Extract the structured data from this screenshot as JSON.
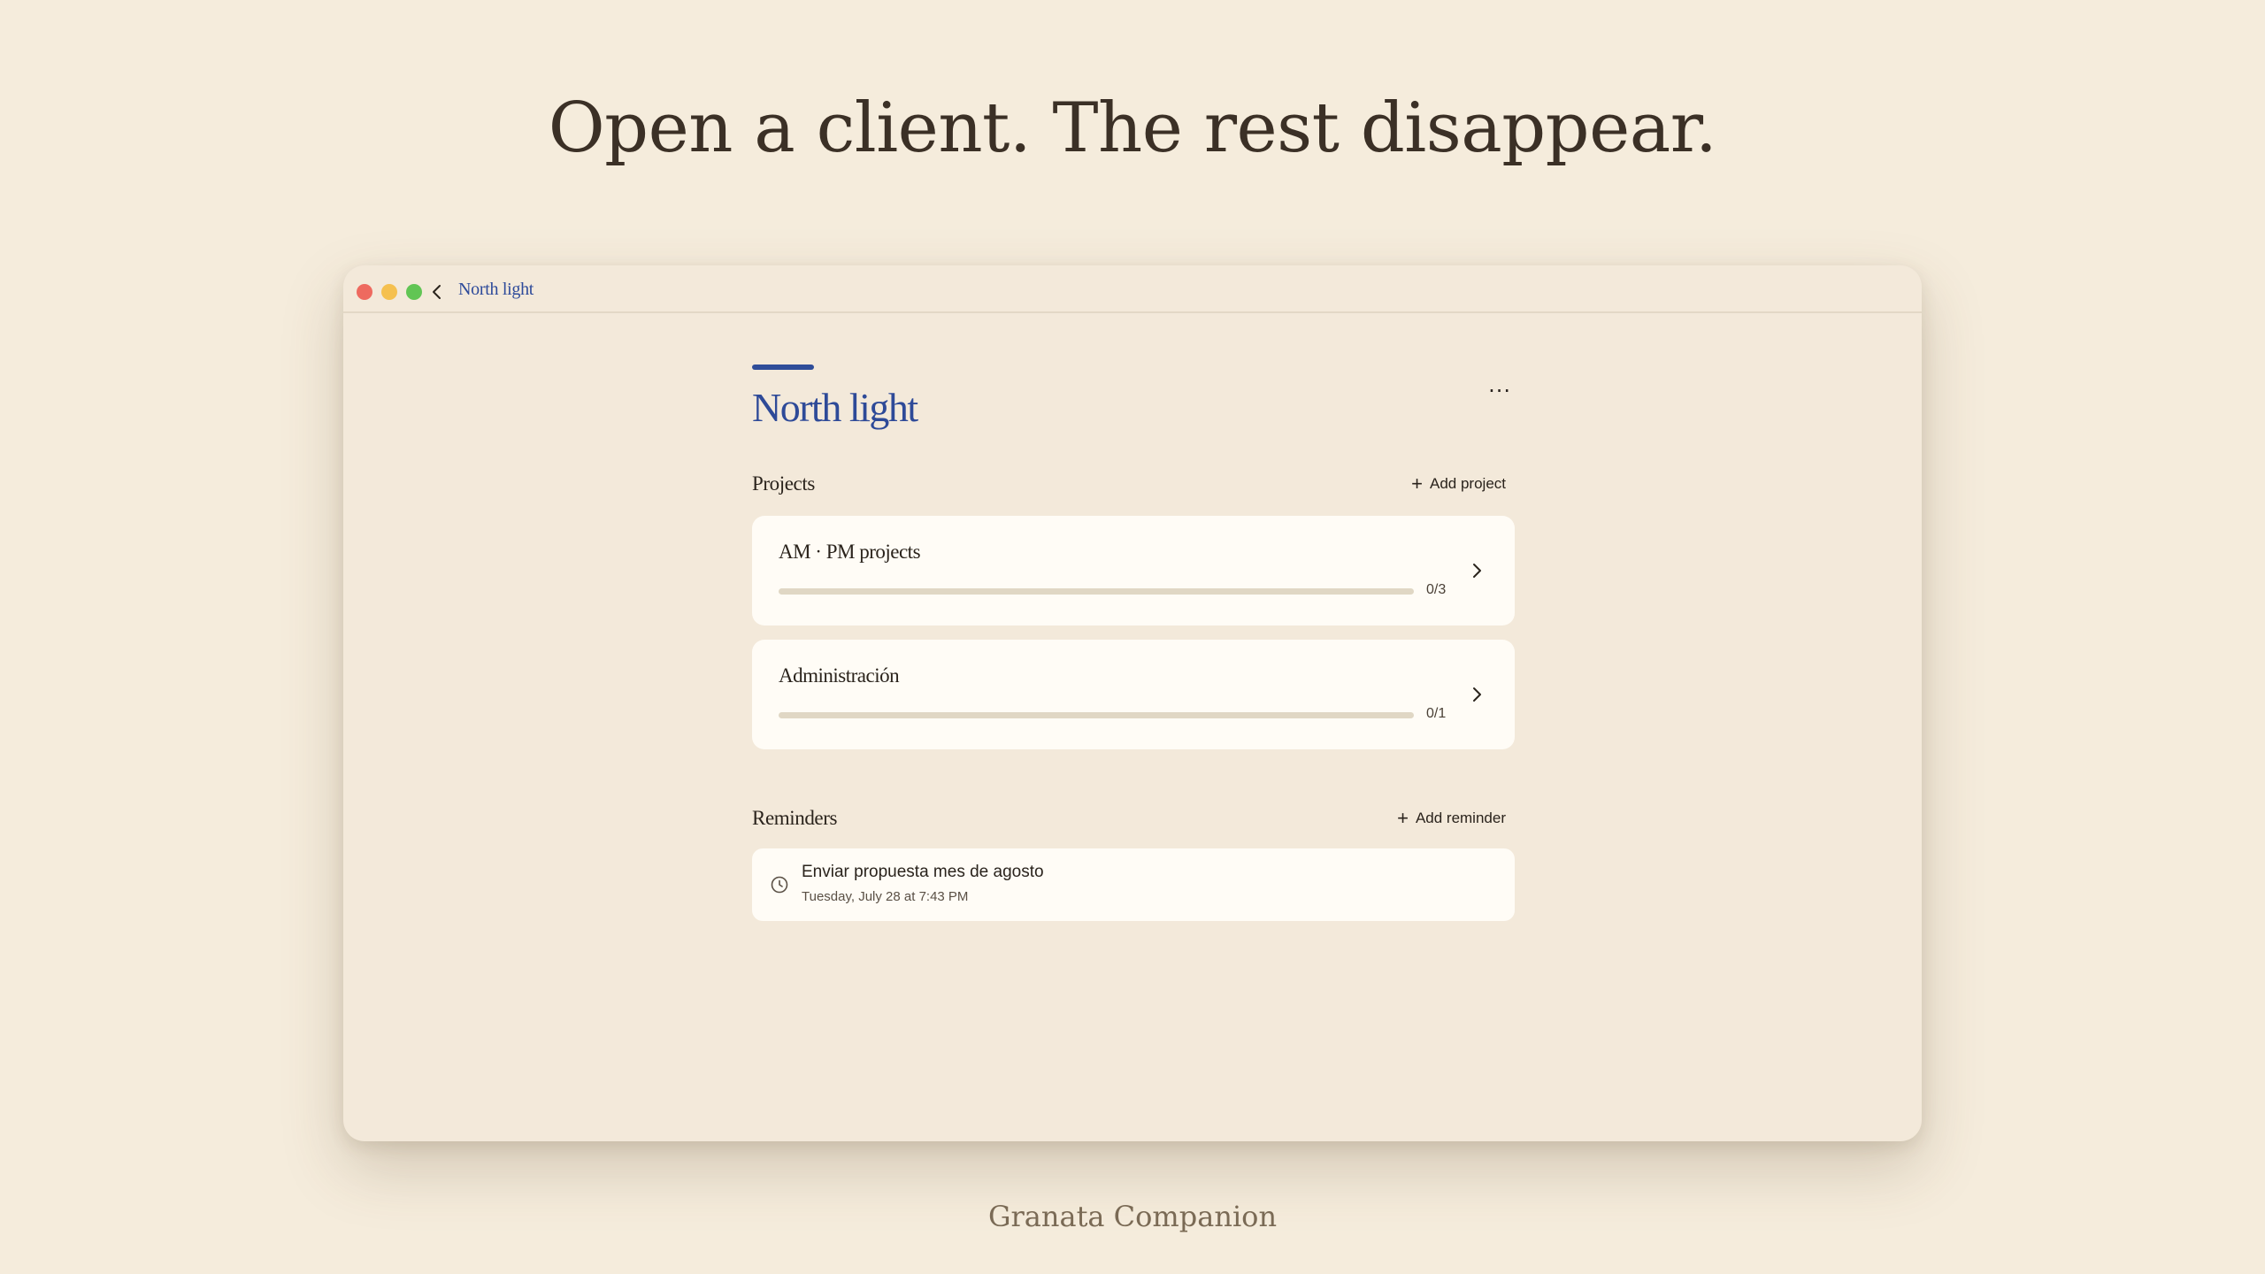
{
  "headline": "Open a client. The rest disappear.",
  "footer": "Granata Companion",
  "window": {
    "title": "North light",
    "icons": {
      "back": "chevron-left-icon",
      "more": "more-horizontal-icon"
    }
  },
  "client": {
    "name": "North light",
    "more_label": "···"
  },
  "projects": {
    "heading": "Projects",
    "add_label": "Add project",
    "items": [
      {
        "name": "AM · PM projects",
        "count": "0/3",
        "progress": 0
      },
      {
        "name": "Administración",
        "count": "0/1",
        "progress": 0
      }
    ]
  },
  "reminders": {
    "heading": "Reminders",
    "add_label": "Add reminder",
    "items": [
      {
        "title": "Enviar propuesta mes de agosto",
        "date": "Tuesday, July 28 at 7:43 PM"
      }
    ]
  },
  "colors": {
    "background": "#f5ecdc",
    "accent": "#2f4d99",
    "card": "#fffcf6"
  }
}
